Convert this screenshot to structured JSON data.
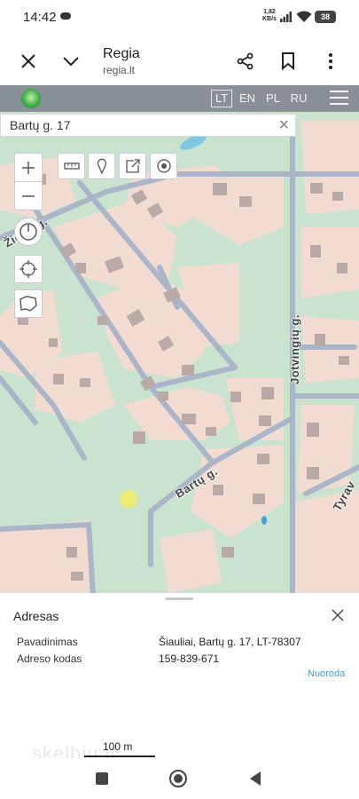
{
  "status": {
    "time": "14:42",
    "speed_value": "1,82",
    "speed_unit": "KB/s",
    "battery": "38"
  },
  "browser": {
    "title": "Regia",
    "url": "regia.lt"
  },
  "map": {
    "languages": [
      "LT",
      "EN",
      "PL",
      "RU"
    ],
    "active_language": "LT",
    "search_value": "Bartų g. 17",
    "streets": {
      "a": "Žiedų g.",
      "b": "Jotvingių g.",
      "c": "Bartų g.",
      "d": "Tyrav"
    }
  },
  "panel": {
    "title": "Adresas",
    "rows": [
      {
        "label": "Pavadinimas",
        "value": "Šiauliai, Bartų g. 17, LT-78307"
      },
      {
        "label": "Adreso kodas",
        "value": "159-839-671"
      }
    ],
    "link": "Nuoroda",
    "scale": "100 m",
    "watermark": "skelbiu.lt"
  },
  "colors": {
    "map_green": "#c9e3cf",
    "building_zone": "#f2dcd2",
    "building": "#b9a9a7",
    "road": "#aab5c9",
    "topbar": "#8a9098",
    "link": "#3fa0d6"
  }
}
